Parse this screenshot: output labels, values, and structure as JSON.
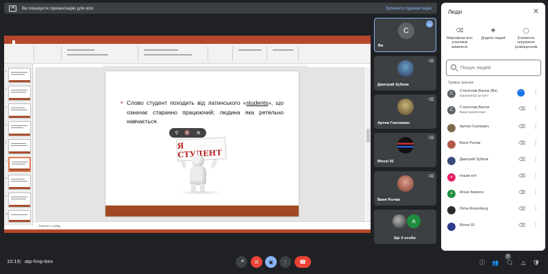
{
  "banner": {
    "text": "Ви показуєте презентацію для всіх",
    "stop_label": "Зупинити презентацію"
  },
  "presentation": {
    "slide_text_before": "Слово студент походить від латинського «",
    "slide_text_link": "students",
    "slide_text_after": "», що означає старанно працюючий; людина яка ретельно навчається.",
    "sign_text": "Я СТУДЕНТ",
    "notes_placeholder": "Заметки к слайду"
  },
  "tiles": [
    {
      "name": "Ви",
      "avatar_letter": "С"
    },
    {
      "name": "Дмитрий Зубков"
    },
    {
      "name": "Артем Гнаткович"
    },
    {
      "name": "Monsi 91"
    },
    {
      "name": "Ваня Рычак"
    },
    {
      "name": "Ще 3 особи",
      "avatar_letter": "A"
    }
  ],
  "panel": {
    "title": "Люди",
    "controls": [
      {
        "label": "Мікрофони всіх учасників вимкнено"
      },
      {
        "label": "Додати людей"
      },
      {
        "label": "Елементи керування розміщенням"
      }
    ],
    "search_placeholder": "Пошук людей",
    "section_label": "Триває виклик",
    "people": [
      {
        "name": "Станіслав Васюк (Ви)",
        "sub": "Організатор зустрічі",
        "avatar": "С",
        "color": "#5f6368"
      },
      {
        "name": "Станіслав Васюк",
        "sub": "Ваша презентація",
        "avatar": "С",
        "color": "#5f6368"
      },
      {
        "name": "Артем Гнаткович",
        "sub": "",
        "avatar": "",
        "color": "#7d6a4a"
      },
      {
        "name": "Ваня Рычак",
        "sub": "",
        "avatar": "",
        "color": "#b35a4a"
      },
      {
        "name": "Дмитрий Зубков",
        "sub": "",
        "avatar": "",
        "color": "#3a4a7a"
      },
      {
        "name": "кошак кот",
        "sub": "",
        "avatar": "к",
        "color": "#e91e63"
      },
      {
        "name": "Ansar Aslanov",
        "sub": "",
        "avatar": "A",
        "color": "#1e8e3e"
      },
      {
        "name": "Dima Rozenberg",
        "sub": "",
        "avatar": "",
        "color": "#2b2b2b"
      },
      {
        "name": "Monsi 91",
        "sub": "",
        "avatar": "",
        "color": "#2b3a8a"
      }
    ]
  },
  "bottom": {
    "time": "10:19",
    "separator": "|",
    "meeting_code": "atp-fvxp-bex",
    "people_count": "9"
  }
}
